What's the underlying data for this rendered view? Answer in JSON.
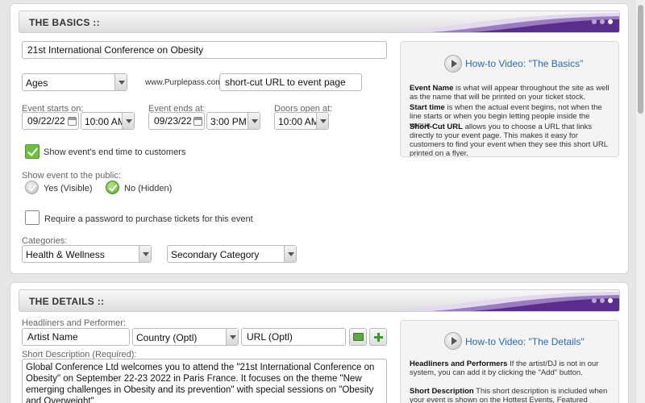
{
  "basics": {
    "title": "THE BASICS ::",
    "event_name": "21st International Conference on Obesity",
    "age_select": "Ages",
    "url_prefix": "www.Purplepass.com/",
    "shortcut_placeholder": "short-cut URL to event page",
    "starts_label": "Event starts on:",
    "start_date": "09/22/22",
    "start_time": "10:00 AM",
    "ends_label": "Event ends at:",
    "end_date": "09/23/22",
    "end_time": "3:00 PM",
    "doors_label": "Doors open at:",
    "doors_time": "10:00 AM",
    "show_end_time_label": "Show event's end time to customers",
    "public_label": "Show event to the public:",
    "public_yes": "Yes (Visible)",
    "public_no": "No (Hidden)",
    "password_label": "Require a password to purchase tickets for this event",
    "categories_label": "Categories:",
    "category_primary": "Health & Wellness",
    "category_secondary": "Secondary Category",
    "help": {
      "video_link": "How-to Video: \"The Basics\"",
      "p1_term": "Event Name",
      "p1_text": " is what will appear throughout the site as well as the name that will be printed on your ticket stock.",
      "p2_term": "Start time",
      "p2_text": " is when the actual event begins, not when the line starts or when you begin letting people inside the venue.",
      "p3_term": "Short-Cut URL",
      "p3_text": " allows you to choose a URL that links directly to your event page. This makes it easy for customers to find your event when they see this short URL printed on a flyer."
    }
  },
  "details": {
    "title": "THE DETAILS ::",
    "headliners_label": "Headliners and Performer:",
    "artist_placeholder": "Artist Name",
    "country_select": "Country (Optl)",
    "url_placeholder": "URL (Optl)",
    "short_desc_label": "Short Description (Required):",
    "short_desc": "Global Conference Ltd welcomes you to attend the \"21st International Conference on Obesity\" on September 22-23 2022 in Paris France. It focuses on the theme \"New emerging challenges in Obesity and its prevention\" with special sessions on \"Obesity and Overweight\".",
    "help": {
      "video_link": "How-to Video: \"The Details\"",
      "p1_term": "Headliners and Performers",
      "p1_text": " If the artist/DJ is not in our system, you can add it by clicking the \"Add\" button.",
      "p2_term": "Short Description",
      "p2_text": " This short description is included when your event is shown on the Hottest Events, Featured Events,"
    }
  },
  "colors": {
    "accent_purple": "#5a2d8c",
    "check_green": "#6cbf3f",
    "link_blue": "#2a6ab5"
  }
}
